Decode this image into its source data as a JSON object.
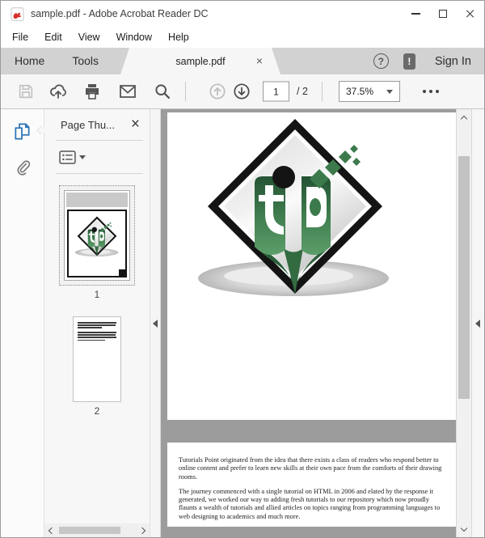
{
  "window": {
    "title": "sample.pdf - Adobe Acrobat Reader DC"
  },
  "menu_bar": {
    "items": [
      {
        "label": "File"
      },
      {
        "label": "Edit"
      },
      {
        "label": "View"
      },
      {
        "label": "Window"
      },
      {
        "label": "Help"
      }
    ]
  },
  "tab_bar": {
    "home_label": "Home",
    "tools_label": "Tools",
    "document_tab_label": "sample.pdf",
    "tab_close_glyph": "×",
    "help_glyph": "?",
    "notification_glyph": "!",
    "sign_in_label": "Sign In"
  },
  "toolbar": {
    "page_current": "1",
    "page_total_label": "/ 2",
    "zoom_value": "37.5%"
  },
  "thumbnails_panel": {
    "title": "Page Thu...",
    "close_glyph": "×",
    "pages": [
      {
        "label": "1"
      },
      {
        "label": "2"
      }
    ]
  },
  "pdf": {
    "page2": {
      "paragraph1": "Tutorials Point originated from the idea that there exists a class of readers who respond better to online content and prefer to learn new skills at their own pace from the comforts of their drawing rooms.",
      "paragraph2": "The journey commenced with a single tutorial on HTML in 2006 and elated by the response it generated, we worked our way to adding fresh tutorials to our repository which now proudly flaunts a wealth of tutorials and allied articles on topics ranging from programming languages to web designing to academics and much more."
    }
  },
  "colors": {
    "acrobat_red": "#d6312b",
    "sidebar_active_blue": "#2a72b5",
    "logo_green_dark": "#245233",
    "logo_green_mid": "#3c7a4c",
    "logo_green_light": "#5c9e6a",
    "viewport_gray": "#9c9c9c",
    "tabbar_gray": "#d2d2d2"
  }
}
